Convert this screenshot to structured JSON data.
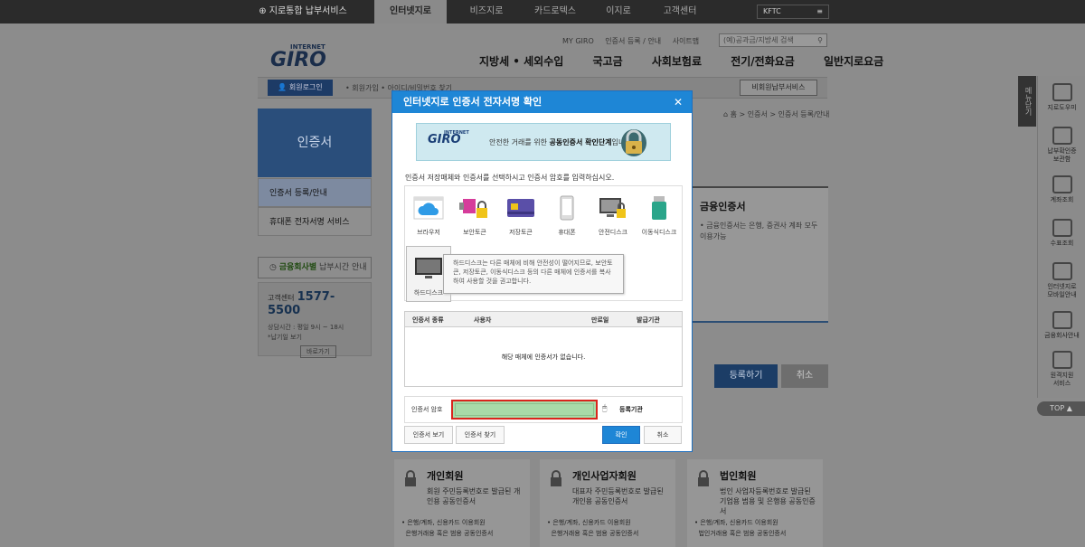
{
  "topbar": {
    "brand": "지로통합 납부서비스",
    "tabs": [
      "인터넷지로",
      "비즈지로",
      "카드로텍스",
      "이지로",
      "고객센터"
    ],
    "kftc": "KFTC"
  },
  "header": {
    "logo_small": "INTERNET",
    "logo": "GIRO",
    "util": [
      "MY GIRO",
      "인증서 등록 / 안내",
      "사이트맵"
    ],
    "search_placeholder": "(예)공과금/지방세 검색",
    "nav": [
      "지방세 • 세외수입",
      "국고금",
      "사회보험료",
      "전기/전화요금",
      "일반지로요금"
    ]
  },
  "subbar": {
    "login": "회원로그인",
    "links": "• 회원가입   • 아이디/비밀번호 찾기",
    "nonmember": "비회원납부서비스"
  },
  "leftmenu": {
    "title": "인증서",
    "items": [
      "인증서 등록/안내",
      "휴대폰 전자서명 서비스"
    ],
    "notice_highlight": "금융회사별",
    "notice_rest": " 납부시간 안내",
    "cs_label": "고객센터",
    "cs_number": "1577-5500",
    "cs_hours": "상담시간 : 평일 9시 ~ 18시",
    "cs_holiday": "*납기일 보기",
    "cs_button": "바로가기"
  },
  "content": {
    "breadcrumb": "홈 > 인증서 > 인증서 등록/안내",
    "fin_title": "금융인증서",
    "fin_desc": "• 금융인증서는 은행, 증권사 계좌 모두 이용가능",
    "register": "등록하기",
    "cancel": "취소",
    "cards": [
      {
        "title": "개인회원",
        "desc": "회원 주민등록번호로 발급된 개인용 공동인증서",
        "list": "• 은행/계좌, 신용카드 이용회원\n  은행거래용 혹은 범용 공동인증서"
      },
      {
        "title": "개인사업자회원",
        "desc": "대표자 주민등록번호로 발급된 개인용 공동인증서",
        "list": "• 은행/계좌, 신용카드 이용회원\n  은행거래용 혹은 범용 공동인증서"
      },
      {
        "title": "법인회원",
        "desc": "법인 사업자등록번호로 발급된 기업용 범용 및 은행용 공동인증서",
        "list": "• 은행/계좌, 신용카드 이용회원\n  법인거래용 혹은 범용 공동인증서"
      }
    ]
  },
  "sidebar": {
    "tab": "메뉴닫기",
    "items": [
      "지로도우미",
      "납부확인증\n보관함",
      "계좌조회",
      "수표조회",
      "인터넷지로\n모바일안내",
      "금융회사안내",
      "원격지원\n서비스"
    ],
    "top": "TOP ▲"
  },
  "modal": {
    "title": "인터넷지로 인증서 전자서명 확인",
    "close": "✕",
    "banner_small": "INTERNET",
    "banner_logo": "GIRO",
    "banner_text_pre": "안전한 거래를 위한 ",
    "banner_text_bold": "공동인증서 확인단계",
    "banner_text_post": "입니다.",
    "instruction": "인증서 저장매체와 인증서를 선택하시고 인증서 암호를 입력하십시오.",
    "media": [
      "브라우저",
      "보안토큰",
      "저장토큰",
      "휴대폰",
      "안전디스크",
      "이동식디스크",
      "하드디스크"
    ],
    "tooltip": "하드디스크는 다른 매체에 비해 안전성이 떨어지므로, 보안토큰, 저장토큰, 이동식디스크 등의 다른 매체에 인증서를 복사하여 사용할 것을 권고합니다.",
    "table_headers": [
      "인증서 종류",
      "사용자",
      "만료일",
      "발급기관"
    ],
    "table_empty": "해당 매체에 인증서가 없습니다.",
    "pw_label": "인증서 암호",
    "pw_value": "",
    "register_org": "등록기관",
    "buttons": {
      "view": "인증서 보기",
      "find": "인증서 찾기",
      "ok": "확인",
      "cancel": "취소"
    }
  }
}
